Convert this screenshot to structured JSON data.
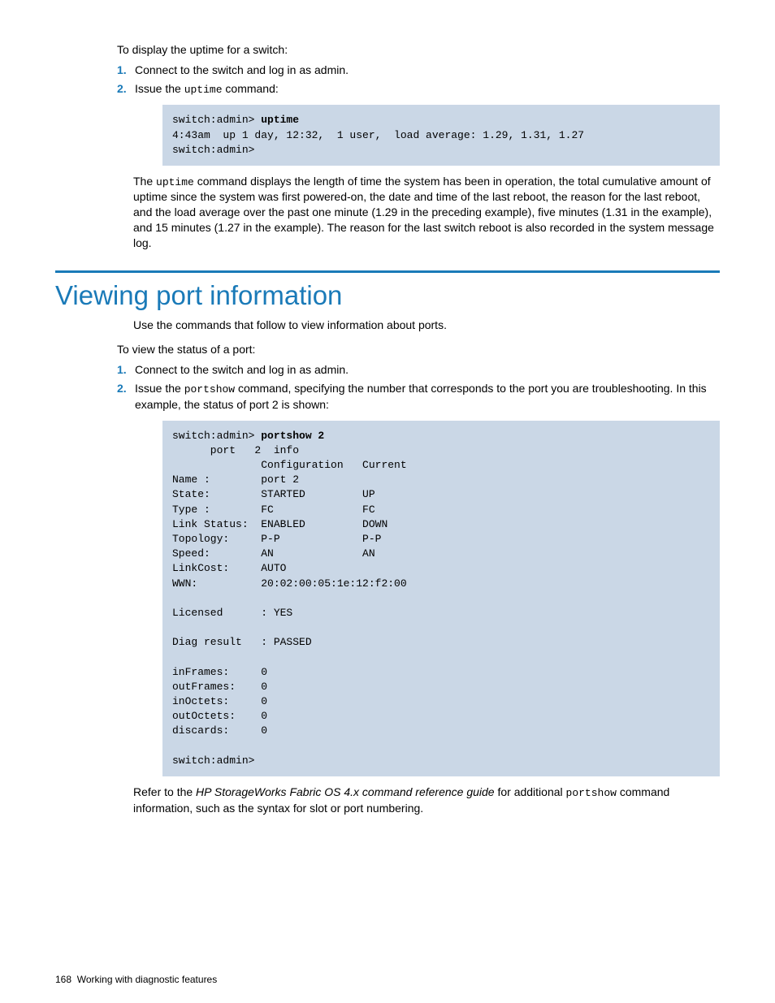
{
  "section1": {
    "intro": "To display the uptime for a switch:",
    "steps": [
      {
        "num": "1.",
        "text": "Connect to the switch and log in as admin."
      },
      {
        "num": "2.",
        "text_pre": "Issue the ",
        "code": "uptime",
        "text_post": " command:"
      }
    ],
    "code": {
      "prompt": "switch:admin> ",
      "cmd": "uptime",
      "lines": "4:43am  up 1 day, 12:32,  1 user,  load average: 1.29, 1.31, 1.27\nswitch:admin>"
    },
    "explain_pre": "The ",
    "explain_code": "uptime",
    "explain_post": " command displays the length of time the system has been in operation, the total cumulative amount of uptime since the system was first powered-on, the date and time of the last reboot, the reason for the last reboot, and the load average over the past one minute (1.29 in the preceding example), five minutes (1.31 in the example), and 15 minutes (1.27 in the example). The reason for the last switch reboot is also recorded in the system message log."
  },
  "section2": {
    "heading": "Viewing port information",
    "lead": "Use the commands that follow to view information about ports.",
    "intro": "To view the status of a port:",
    "steps": [
      {
        "num": "1.",
        "text": "Connect to the switch and log in as admin."
      },
      {
        "num": "2.",
        "text_pre": "Issue the ",
        "code": "portshow",
        "text_post": " command, specifying the number that corresponds to the port you are troubleshooting. In this example, the status of port 2 is shown:"
      }
    ],
    "code": {
      "prompt": "switch:admin> ",
      "cmd": "portshow 2",
      "lines": "      port   2  info\n              Configuration   Current\nName :        port 2\nState:        STARTED         UP\nType :        FC              FC\nLink Status:  ENABLED         DOWN\nTopology:     P-P             P-P\nSpeed:        AN              AN\nLinkCost:     AUTO\nWWN:          20:02:00:05:1e:12:f2:00\n\nLicensed      : YES\n\nDiag result   : PASSED\n\ninFrames:     0\noutFrames:    0\ninOctets:     0\noutOctets:    0\ndiscards:     0\n\nswitch:admin>"
    },
    "footnote_pre": "Refer to the ",
    "footnote_italic": "HP StorageWorks Fabric OS 4.x command reference guide",
    "footnote_mid": " for additional ",
    "footnote_code": "portshow",
    "footnote_post": " command information, such as the syntax for slot or port numbering."
  },
  "footer": {
    "page": "168",
    "title": "Working with diagnostic features"
  }
}
